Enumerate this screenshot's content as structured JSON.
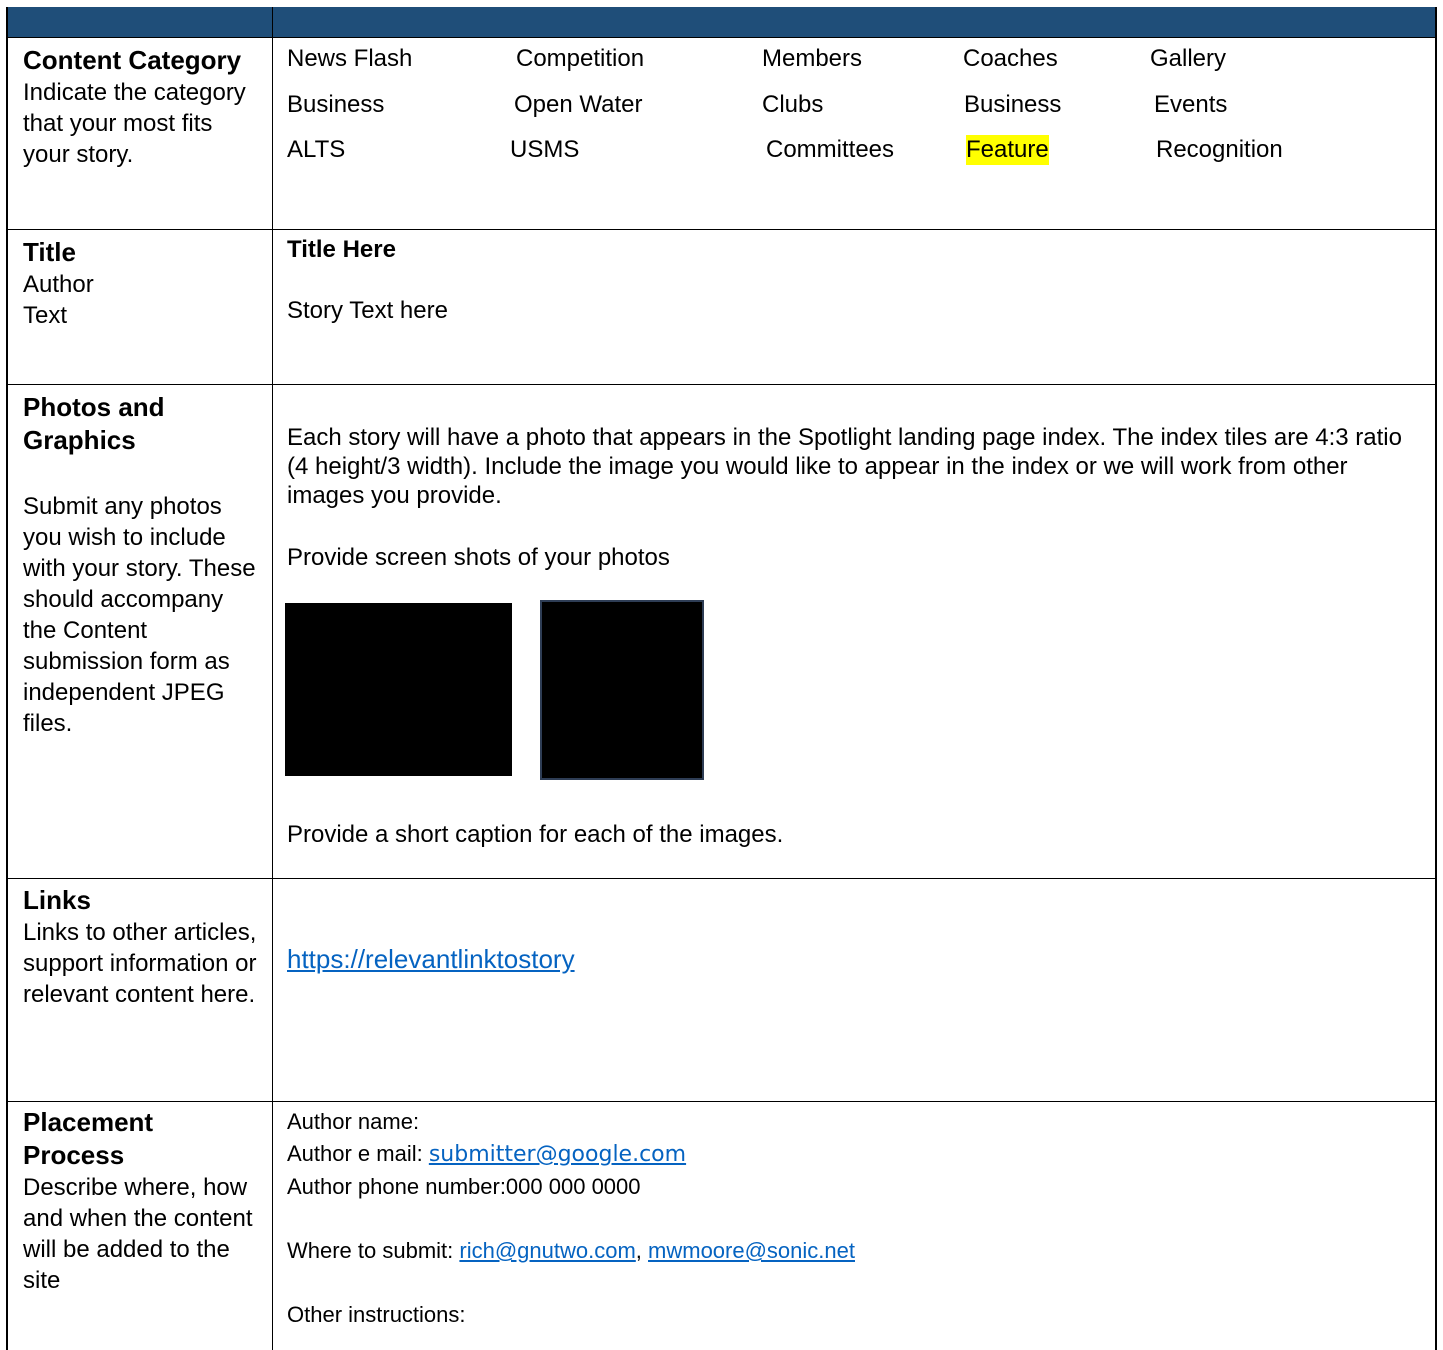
{
  "categories": {
    "label": "Content Category",
    "description": "Indicate the category that your most fits your story.",
    "items": [
      "News Flash",
      "Competition",
      "Members",
      "Coaches",
      "Gallery",
      "Business",
      "Open Water",
      "Clubs",
      "Business",
      "Events",
      "ALTS",
      "USMS",
      "Committees",
      "Feature",
      "Recognition"
    ],
    "highlighted": "Feature",
    "highlight_color": "#ffff00"
  },
  "title_row": {
    "label": "Title",
    "sub1": "Author",
    "sub2": "Text",
    "title_value": "Title Here",
    "story_text": "Story Text here"
  },
  "photos": {
    "label1": "Photos and",
    "label2": "Graphics",
    "description": "Submit any photos you wish to include with your story. These should accompany the Content submission form as independent JPEG files.",
    "info": "Each story will have a photo that appears in the Spotlight landing page index. The index tiles are 4:3 ratio (4 height/3 width). Include the image you would like to appear in the index or we will work from other images you provide.",
    "screenshots_prompt": "Provide screen shots of your photos",
    "caption_prompt": "Provide a short caption for each of the images."
  },
  "links": {
    "label": "Links",
    "description": "Links to other articles, support information or relevant content here.",
    "url": "https://relevantlinktostory"
  },
  "placement": {
    "label1": "Placement",
    "label2": "Process",
    "description": "Describe where, how and when the content will be added to the site",
    "author_name": "Author name:",
    "author_email_label": "Author e mail: ",
    "author_email": "submitter@google.com",
    "author_phone": "Author phone number:000 000 0000",
    "submit_label": "Where to submit: ",
    "submit_email1": "rich@gnutwo.com",
    "submit_sep": ", ",
    "submit_email2": "mwmoore@sonic.net",
    "other": "Other instructions:"
  },
  "colors": {
    "header": "#1f4e79",
    "link": "#0563c1"
  }
}
